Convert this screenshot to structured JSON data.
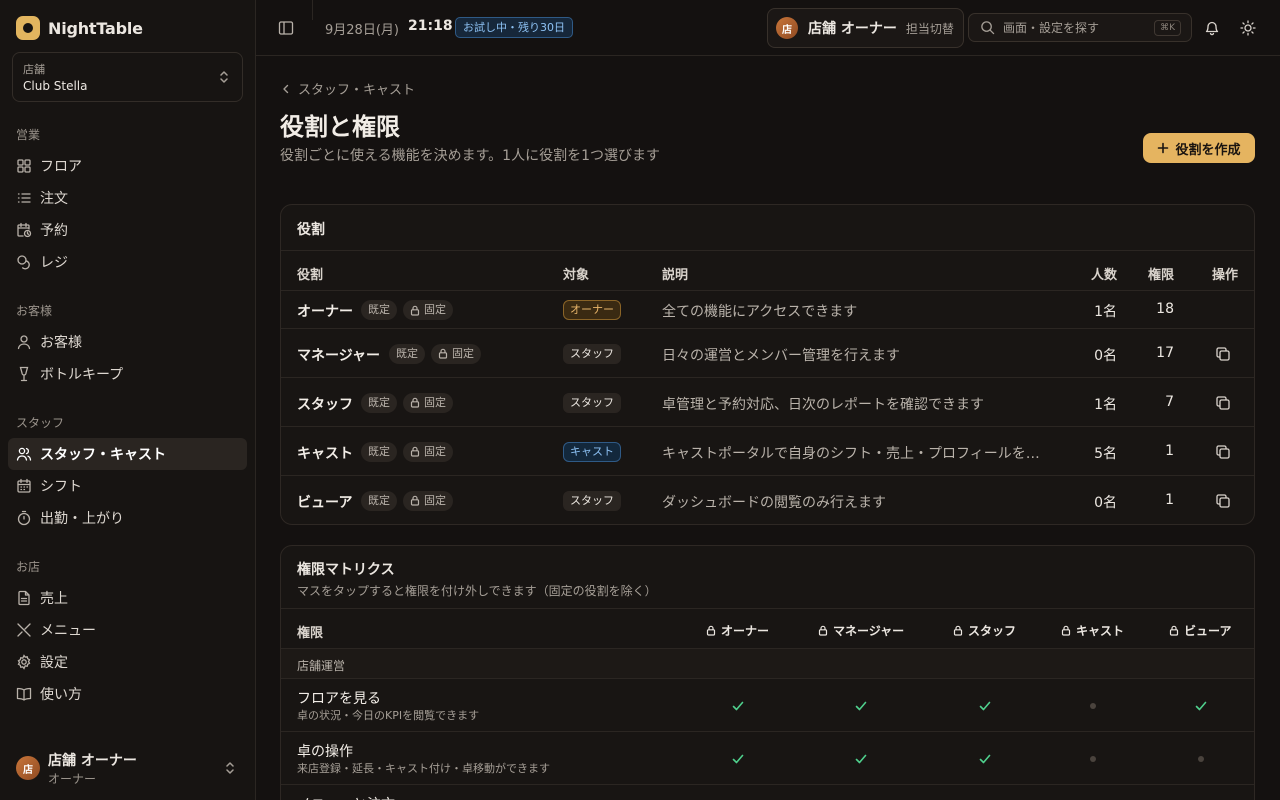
{
  "brand": {
    "name": "NightTable"
  },
  "store": {
    "label": "店舗",
    "name": "Club Stella"
  },
  "sidebar": {
    "sections": [
      {
        "title": "営業",
        "items": [
          {
            "label": "フロア",
            "icon": "grid-icon"
          },
          {
            "label": "注文",
            "icon": "list-icon"
          },
          {
            "label": "予約",
            "icon": "calendar-clock-icon"
          },
          {
            "label": "レジ",
            "icon": "coins-icon"
          }
        ]
      },
      {
        "title": "お客様",
        "items": [
          {
            "label": "お客様",
            "icon": "user-icon"
          },
          {
            "label": "ボトルキープ",
            "icon": "bottle-icon"
          }
        ]
      },
      {
        "title": "スタッフ",
        "items": [
          {
            "label": "スタッフ・キャスト",
            "icon": "users-icon",
            "active": true
          },
          {
            "label": "シフト",
            "icon": "calendar-icon"
          },
          {
            "label": "出勤・上がり",
            "icon": "timer-icon"
          }
        ]
      },
      {
        "title": "お店",
        "items": [
          {
            "label": "売上",
            "icon": "file-icon"
          },
          {
            "label": "メニュー",
            "icon": "utensils-icon"
          },
          {
            "label": "設定",
            "icon": "gear-icon"
          },
          {
            "label": "使い方",
            "icon": "book-icon"
          }
        ]
      }
    ],
    "user": {
      "avatar": "店",
      "name": "店舗 オーナー",
      "role": "オーナー"
    }
  },
  "header": {
    "date": "9月28日(月)",
    "time": "21:18",
    "trial": "お試し中・残り30日",
    "owner": {
      "avatar": "店",
      "name": "店舗 オーナー",
      "switch": "担当切替"
    },
    "search": {
      "placeholder": "画面・設定を探す",
      "shortcut": "⌘K"
    }
  },
  "page": {
    "breadcrumb": "スタッフ・キャスト",
    "title": "役割と権限",
    "subtitle": "役割ごとに使える機能を決めます。1人に役割を1つ選びます",
    "create_button": "役割を作成"
  },
  "roles_card": {
    "title": "役割",
    "columns": {
      "role": "役割",
      "target": "対象",
      "description": "説明",
      "count": "人数",
      "permissions": "権限",
      "actions": "操作"
    },
    "tags": {
      "default": "既定",
      "locked": "固定"
    },
    "rows": [
      {
        "name": "オーナー",
        "target": "オーナー",
        "target_type": "owner",
        "description": "全ての機能にアクセスできます",
        "count": "1名",
        "permissions": "18",
        "copy": false
      },
      {
        "name": "マネージャー",
        "target": "スタッフ",
        "target_type": "staff",
        "description": "日々の運営とメンバー管理を行えます",
        "count": "0名",
        "permissions": "17",
        "copy": true
      },
      {
        "name": "スタッフ",
        "target": "スタッフ",
        "target_type": "staff",
        "description": "卓管理と予約対応、日次のレポートを確認できます",
        "count": "1名",
        "permissions": "7",
        "copy": true
      },
      {
        "name": "キャスト",
        "target": "キャスト",
        "target_type": "cast",
        "description": "キャストポータルで自身のシフト・売上・プロフィールを確…",
        "count": "5名",
        "permissions": "1",
        "copy": true
      },
      {
        "name": "ビューア",
        "target": "スタッフ",
        "target_type": "staff",
        "description": "ダッシュボードの閲覧のみ行えます",
        "count": "0名",
        "permissions": "1",
        "copy": true
      }
    ]
  },
  "matrix_card": {
    "title": "権限マトリクス",
    "description": "マスをタップすると権限を付け外しできます（固定の役割を除く）",
    "header_label": "権限",
    "columns": [
      "オーナー",
      "マネージャー",
      "スタッフ",
      "キャスト",
      "ビューア"
    ],
    "group": "店舗運営",
    "rows": [
      {
        "name": "フロアを見る",
        "description": "卓の状況・今日のKPIを閲覧できます",
        "cells": [
          true,
          true,
          true,
          false,
          true
        ]
      },
      {
        "name": "卓の操作",
        "description": "来店登録・延長・キャスト付け・卓移動ができます",
        "cells": [
          true,
          true,
          true,
          false,
          false
        ]
      },
      {
        "name": "メニューと注文",
        "description": "",
        "cells": [
          true,
          true,
          true,
          false,
          false
        ]
      }
    ]
  },
  "colors": {
    "accent": "#e5b460",
    "check": "#4fd08d",
    "background": "#141110"
  }
}
